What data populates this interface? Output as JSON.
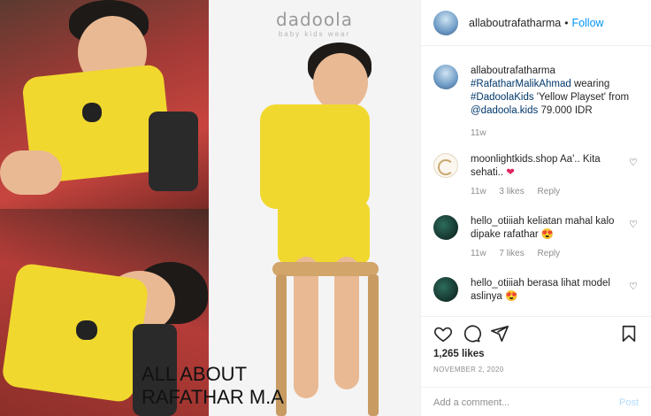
{
  "media": {
    "brand": "dadoola",
    "brand_sub": "baby kids wear",
    "watermark_line1": "ALL ABOUT",
    "watermark_line2": "RAFATHAR M.A"
  },
  "header": {
    "username": "allaboutrafatharma",
    "dot": "•",
    "follow_label": "Follow"
  },
  "caption": {
    "username": "allaboutrafatharma",
    "mention": "#RafatharMalikAhmad",
    "text1": " wearing ",
    "hashtag": "#DadoolaKids",
    "text2": " 'Yellow Playset' from ",
    "account": "@dadoola.kids",
    "text3": " 79.000 IDR",
    "time": "11w"
  },
  "comments": [
    {
      "username": "moonlightkids.shop",
      "text": " Aa'.. Kita sehati.. ",
      "emoji": "❤",
      "time": "11w",
      "likes": "3 likes",
      "reply": "Reply"
    },
    {
      "username": "hello_otiiiah",
      "text": " keliatan mahal kalo dipake rafathar ",
      "emoji": "😍",
      "time": "11w",
      "likes": "7 likes",
      "reply": "Reply"
    },
    {
      "username": "hello_otiiiah",
      "text": " berasa lihat model aslinya ",
      "emoji": "😍",
      "time": "",
      "likes": "",
      "reply": ""
    }
  ],
  "stats": {
    "likes": "1,265 likes",
    "date": "NOVEMBER 2, 2020"
  },
  "comment_box": {
    "placeholder": "Add a comment...",
    "post_label": "Post"
  },
  "icons": [
    "heart-icon",
    "comment-icon",
    "share-icon",
    "bookmark-icon"
  ]
}
